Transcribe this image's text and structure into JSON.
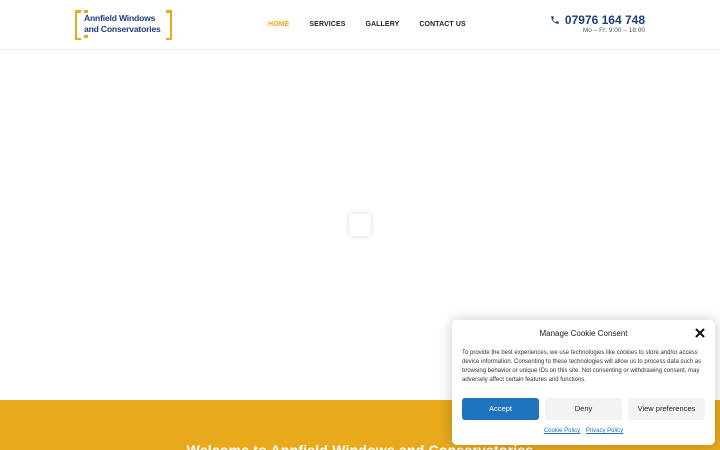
{
  "brand": {
    "line1": "Annfield Windows",
    "line2": "and Conservatories",
    "accent_color": "#e8a91c",
    "text_color": "#1f3d7a"
  },
  "nav": {
    "items": [
      {
        "label": "HOME",
        "active": true
      },
      {
        "label": "SERVICES",
        "active": false
      },
      {
        "label": "GALLERY",
        "active": false
      },
      {
        "label": "CONTACT US",
        "active": false
      }
    ]
  },
  "contact": {
    "icon": "phone-icon",
    "phone": "07976 164 748",
    "hours": "Mo – Fr: 9:00 – 18:00"
  },
  "hero": {
    "loading_icon": "loader-spinner"
  },
  "band": {
    "title": "Welcome to Annfield Windows and Conservatories",
    "color": "#e8a91c"
  },
  "cookie": {
    "title": "Manage Cookie Consent",
    "body": "To provide the best experiences, we use technologies like cookies to store and/or access device information. Consenting to these technologies will allow us to process data such as browsing behavior or unique IDs on this site. Not consenting or withdrawing consent, may adversely affect certain features and functions.",
    "accept_label": "Accept",
    "deny_label": "Deny",
    "prefs_label": "View preferences",
    "cookie_policy_label": "Cookie Policy",
    "privacy_policy_label": "Privacy Policy",
    "close_icon": "close-icon",
    "accept_color": "#1e73be"
  }
}
